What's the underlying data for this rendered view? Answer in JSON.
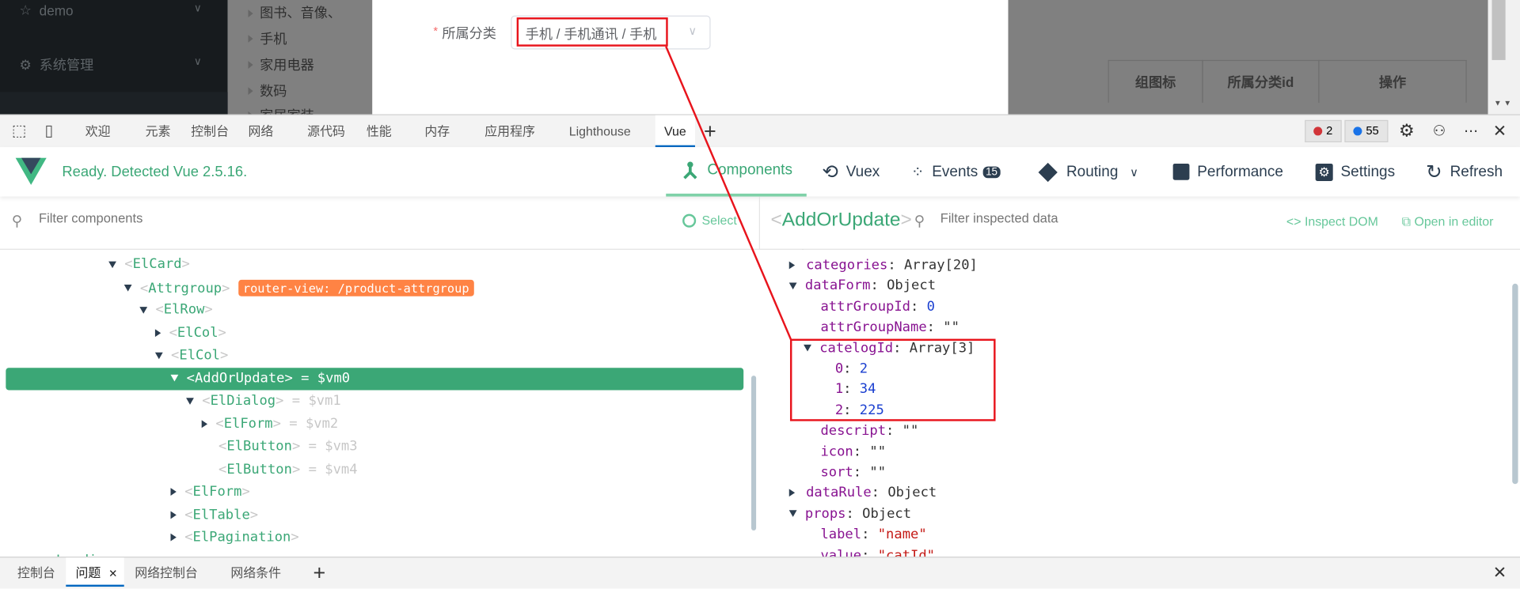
{
  "page": {
    "sidebar": [
      {
        "label": "demo",
        "icon": "star-icon"
      },
      {
        "label": "系统管理",
        "icon": "gear-icon"
      }
    ],
    "category_tree": [
      "图书、音像、",
      "手机",
      "家用电器",
      "数码",
      "家居家装"
    ],
    "form": {
      "required_mark": "*",
      "label": "所属分类",
      "cascader_value": "手机 / 手机通讯 / 手机"
    },
    "table_headers": [
      "组图标",
      "所属分类id",
      "操作"
    ]
  },
  "devtools": {
    "tabs": [
      "欢迎",
      "元素",
      "控制台",
      "网络",
      "源代码",
      "性能",
      "内存",
      "应用程序",
      "Lighthouse",
      "Vue"
    ],
    "active_tab": "Vue",
    "error_count": "2",
    "message_count": "55"
  },
  "vue": {
    "status": "Ready. Detected Vue 2.5.16.",
    "nav": {
      "components": "Components",
      "vuex": "Vuex",
      "events": "Events",
      "events_badge": "15",
      "routing": "Routing",
      "performance": "Performance",
      "settings": "Settings",
      "refresh": "Refresh"
    },
    "filter_components_placeholder": "Filter components",
    "select_label": "Select",
    "inspected_component": "AddOrUpdate",
    "filter_data_placeholder": "Filter inspected data",
    "inspect_dom": "Inspect DOM",
    "open_in_editor": "Open in editor",
    "tree": [
      {
        "name": "ElCard",
        "arrow": "down",
        "depth": 0,
        "vm": ""
      },
      {
        "name": "Attrgroup",
        "arrow": "down",
        "depth": 1,
        "vm": "",
        "badge": "router-view: /product-attrgroup"
      },
      {
        "name": "ElRow",
        "arrow": "down",
        "depth": 2,
        "vm": ""
      },
      {
        "name": "ElCol",
        "arrow": "right",
        "depth": 3,
        "vm": ""
      },
      {
        "name": "ElCol",
        "arrow": "down",
        "depth": 3,
        "vm": ""
      },
      {
        "name": "AddOrUpdate",
        "arrow": "down",
        "depth": 4,
        "vm": "= $vm0",
        "selected": true
      },
      {
        "name": "ElDialog",
        "arrow": "down",
        "depth": 5,
        "vm": "= $vm1"
      },
      {
        "name": "ElForm",
        "arrow": "right",
        "depth": 6,
        "vm": "= $vm2"
      },
      {
        "name": "ElButton",
        "arrow": "none",
        "depth": 6,
        "vm": "= $vm3"
      },
      {
        "name": "ElButton",
        "arrow": "none",
        "depth": 6,
        "vm": "= $vm4"
      },
      {
        "name": "ElForm",
        "arrow": "right",
        "depth": 4,
        "vm": ""
      },
      {
        "name": "ElTable",
        "arrow": "right",
        "depth": 4,
        "vm": ""
      },
      {
        "name": "ElPagination",
        "arrow": "right",
        "depth": 4,
        "vm": ""
      },
      {
        "name": "Loading",
        "arrow": "none",
        "depth": -5,
        "vm": ""
      }
    ],
    "data": [
      {
        "key": "categories",
        "value": "Array[20]",
        "type": "obj",
        "arrow": "right",
        "depth": 0
      },
      {
        "key": "dataForm",
        "value": "Object",
        "type": "obj",
        "arrow": "down",
        "depth": 0
      },
      {
        "key": "attrGroupId",
        "value": "0",
        "type": "num",
        "arrow": "none",
        "depth": 1
      },
      {
        "key": "attrGroupName",
        "value": "\"\"",
        "type": "obj",
        "arrow": "none",
        "depth": 1
      },
      {
        "key": "catelogId",
        "value": "Array[3]",
        "type": "obj",
        "arrow": "down",
        "depth": 1,
        "highlight": true
      },
      {
        "key": "0",
        "value": "2",
        "type": "num",
        "arrow": "none",
        "depth": 2
      },
      {
        "key": "1",
        "value": "34",
        "type": "num",
        "arrow": "none",
        "depth": 2
      },
      {
        "key": "2",
        "value": "225",
        "type": "num",
        "arrow": "none",
        "depth": 2
      },
      {
        "key": "descript",
        "value": "\"\"",
        "type": "obj",
        "arrow": "none",
        "depth": 1
      },
      {
        "key": "icon",
        "value": "\"\"",
        "type": "obj",
        "arrow": "none",
        "depth": 1
      },
      {
        "key": "sort",
        "value": "\"\"",
        "type": "obj",
        "arrow": "none",
        "depth": 1
      },
      {
        "key": "dataRule",
        "value": "Object",
        "type": "obj",
        "arrow": "right",
        "depth": 0
      },
      {
        "key": "props",
        "value": "Object",
        "type": "obj",
        "arrow": "down",
        "depth": 0
      },
      {
        "key": "label",
        "value": "\"name\"",
        "type": "str",
        "arrow": "none",
        "depth": 1
      },
      {
        "key": "value",
        "value": "\"catId\"",
        "type": "str",
        "arrow": "none",
        "depth": 1
      }
    ]
  },
  "drawer": {
    "tabs": [
      "控制台",
      "问题",
      "网络控制台",
      "网络条件"
    ],
    "active_tab": "问题"
  },
  "colors": {
    "vue_green": "#3ba776",
    "annotation_red": "#e8141c",
    "badge_orange": "#ff8344",
    "tab_blue": "#0067c0"
  }
}
